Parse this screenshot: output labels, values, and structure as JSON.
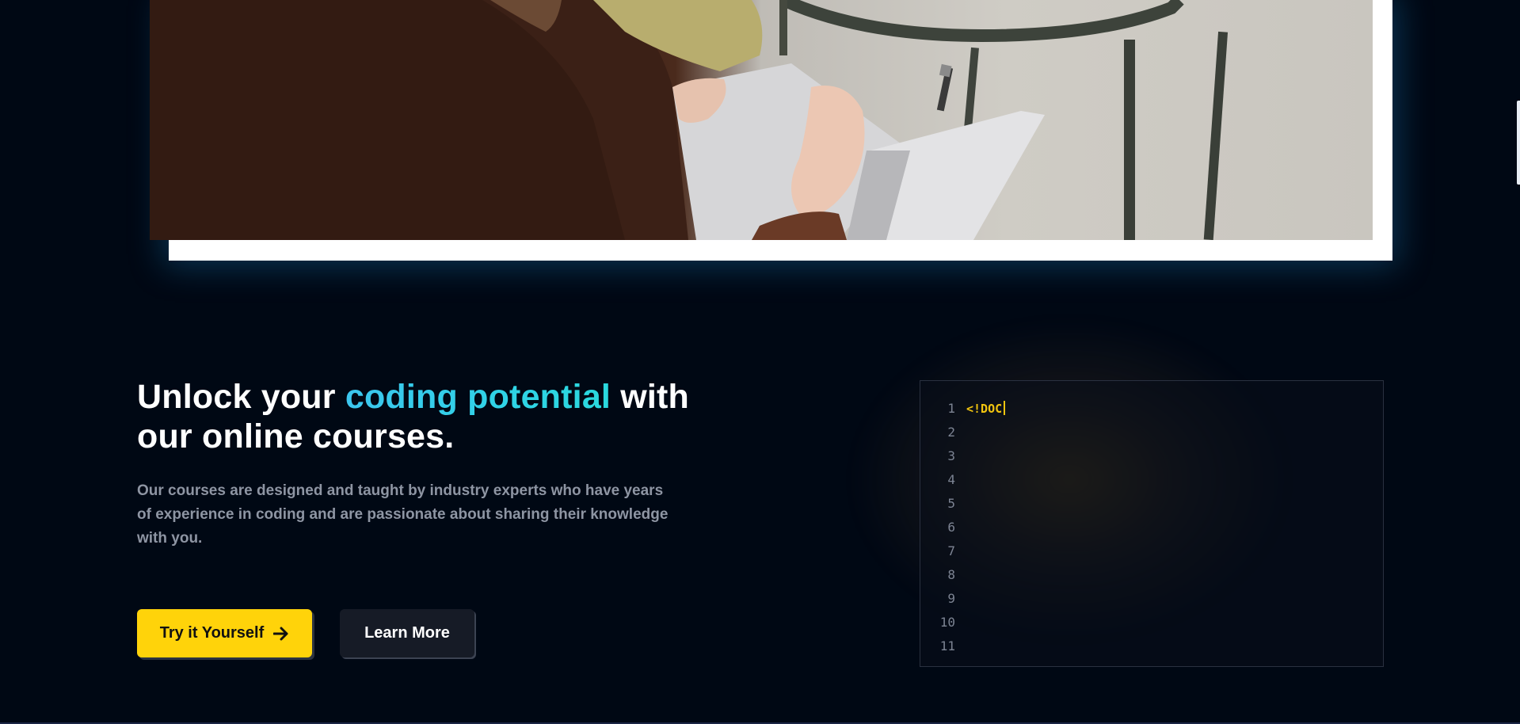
{
  "hero": {
    "image_alt": "Person writing in a notebook"
  },
  "headline": {
    "part1": "Unlock your ",
    "accent": "coding potential",
    "part2": " with our online courses."
  },
  "lead": "Our courses are designed and taught by industry experts who have years of experience in coding and are passionate about sharing their knowledge with you.",
  "buttons": {
    "primary_label": "Try it Yourself",
    "primary_icon": "arrow-right-icon",
    "secondary_label": "Learn More"
  },
  "editor": {
    "line_numbers": [
      "1",
      "2",
      "3",
      "4",
      "5",
      "6",
      "7",
      "8",
      "9",
      "10",
      "11"
    ],
    "code": "<!DOC"
  },
  "colors": {
    "background": "#000814",
    "accent_cyan": "#2fd3e6",
    "button_yellow": "#ffd30a",
    "code_yellow": "#f1c40f"
  }
}
